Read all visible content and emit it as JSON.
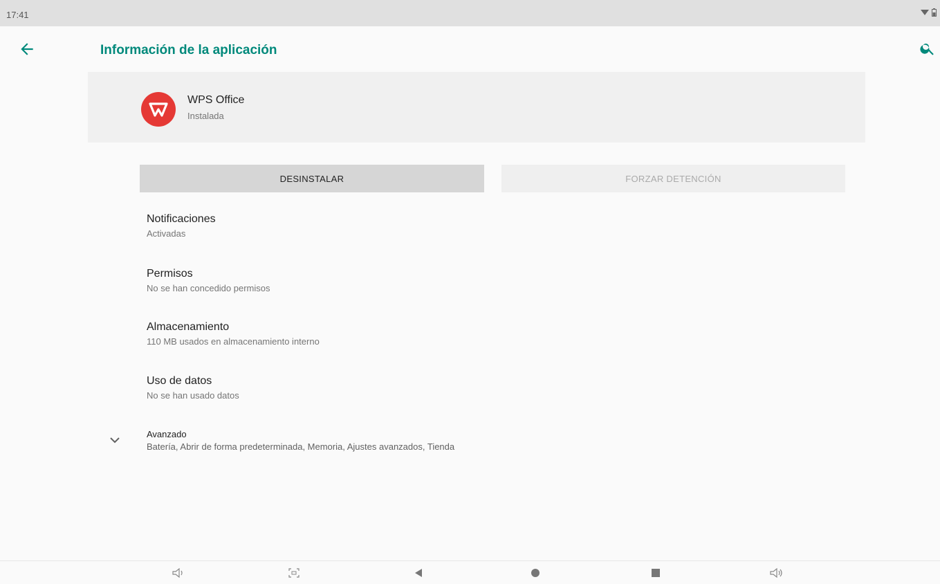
{
  "status_bar": {
    "time": "17:41",
    "icons": [
      "wifi-icon",
      "battery-icon"
    ]
  },
  "app_bar": {
    "title": "Información de la aplicación",
    "back_icon": "arrow-back-icon",
    "search_icon": "search-icon",
    "accent": "#00897b"
  },
  "app": {
    "name": "WPS Office",
    "status": "Instalada",
    "icon": "wps-office-logo",
    "icon_color": "#e53935"
  },
  "actions": {
    "uninstall_label": "DESINSTALAR",
    "force_stop_label": "FORZAR DETENCIÓN"
  },
  "settings": [
    {
      "title": "Notificaciones",
      "subtitle": "Activadas"
    },
    {
      "title": "Permisos",
      "subtitle": "No se han concedido permisos"
    },
    {
      "title": "Almacenamiento",
      "subtitle": "110 MB usados en almacenamiento interno"
    },
    {
      "title": "Uso de datos",
      "subtitle": "No se han usado datos"
    }
  ],
  "advanced": {
    "title": "Avanzado",
    "subtitle": "Batería, Abrir de forma predeterminada, Memoria, Ajustes avanzados, Tienda",
    "icon": "chevron-down-icon"
  },
  "nav_bar": {
    "icons": [
      "volume-down-icon",
      "screenshot-icon",
      "back-triangle-icon",
      "home-circle-icon",
      "recents-square-icon",
      "volume-up-icon"
    ]
  }
}
